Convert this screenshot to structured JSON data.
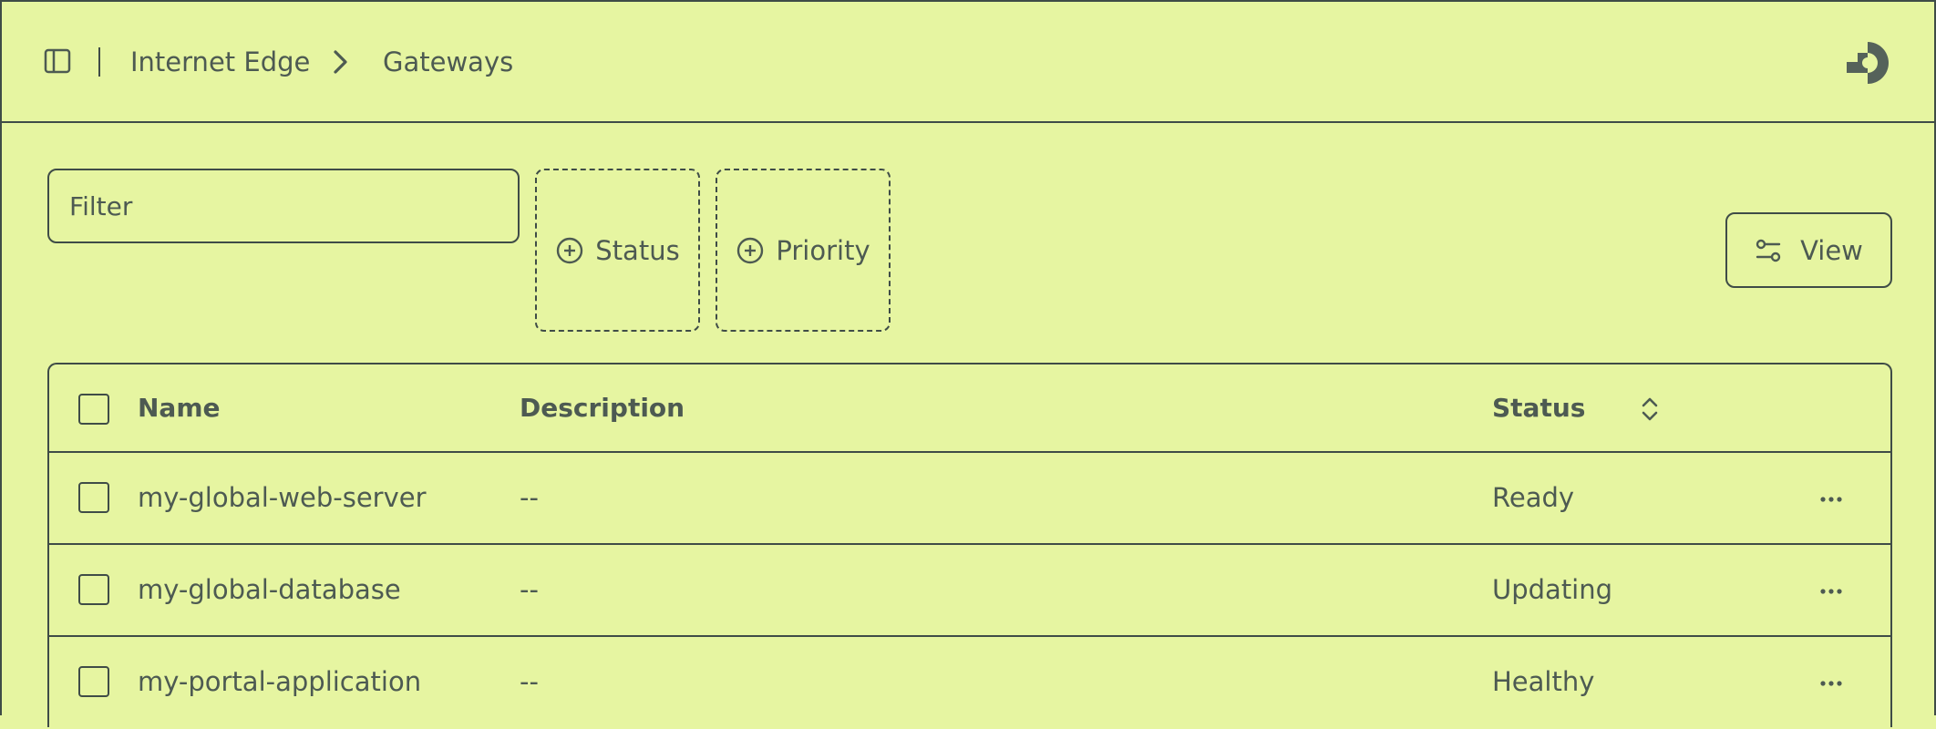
{
  "header": {
    "breadcrumb": [
      "Internet Edge",
      "Gateways"
    ]
  },
  "toolbar": {
    "filter_placeholder": "Filter",
    "chips": [
      "Status",
      "Priority"
    ],
    "view_label": "View"
  },
  "table": {
    "columns": [
      "Name",
      "Description",
      "Status"
    ],
    "rows": [
      {
        "name": "my-global-web-server",
        "description": "--",
        "status": "Ready"
      },
      {
        "name": "my-global-database",
        "description": "--",
        "status": "Updating"
      },
      {
        "name": "my-portal-application",
        "description": "--",
        "status": "Healthy"
      }
    ]
  },
  "icons": {
    "sidebar": "sidebar-icon",
    "chevron": "chevron-right-icon",
    "logo": "app-logo",
    "add": "plus-circle-icon",
    "settings": "sliders-icon",
    "sort": "sort-icon",
    "more": "more-horizontal-icon"
  },
  "colors": {
    "background": "#e6f5a1",
    "foreground": "#4d5a52",
    "border": "#3f4c47"
  }
}
